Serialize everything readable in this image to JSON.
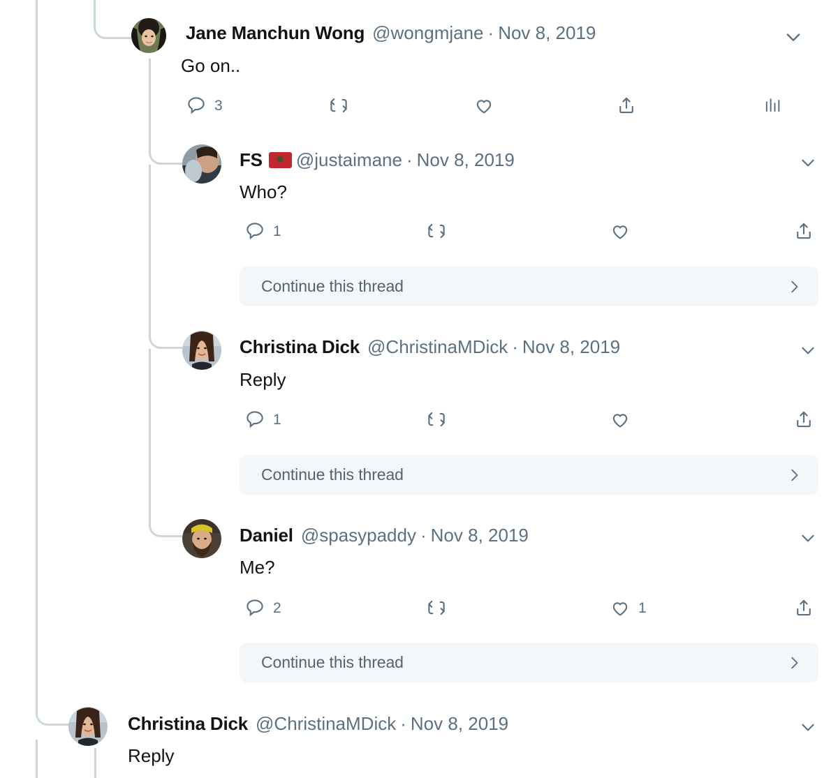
{
  "theme": {
    "background": "#ffffff",
    "text_primary": "#0f1419",
    "text_secondary": "#5b7083",
    "connector": "#ccd6dd",
    "banner_bg": "#f4f7f9",
    "banner_text": "#536471",
    "flag_red": "#c1272d",
    "flag_green": "#006233"
  },
  "tweets": [
    {
      "id": "jane-go-on",
      "display_name": "Jane Manchun Wong",
      "handle": "@wongmjane",
      "separator": "·",
      "date": "Nov 8, 2019",
      "body": "Go on..",
      "caret": "chevron-down",
      "actions": {
        "reply": "3",
        "retweet": "",
        "like": "",
        "share": "",
        "analytics": ""
      },
      "has_analytics": true,
      "continue_thread": null
    },
    {
      "id": "fs-who",
      "display_name": "FS",
      "flag": "morocco",
      "handle": "@justaimane",
      "separator": "·",
      "date": "Nov 8, 2019",
      "body": "Who?",
      "caret": "chevron-down",
      "actions": {
        "reply": "1",
        "retweet": "",
        "like": "",
        "share": ""
      },
      "has_analytics": false,
      "continue_thread": "Continue this thread"
    },
    {
      "id": "christina-reply-1",
      "display_name": "Christina Dick",
      "handle": "@ChristinaMDick",
      "separator": "·",
      "date": "Nov 8, 2019",
      "body": "Reply",
      "caret": "chevron-down",
      "actions": {
        "reply": "1",
        "retweet": "",
        "like": "",
        "share": ""
      },
      "has_analytics": false,
      "continue_thread": "Continue this thread"
    },
    {
      "id": "daniel-me",
      "display_name": "Daniel",
      "handle": "@spasypaddy",
      "separator": "·",
      "date": "Nov 8, 2019",
      "body": "Me?",
      "caret": "chevron-down",
      "actions": {
        "reply": "2",
        "retweet": "",
        "like": "1",
        "share": ""
      },
      "has_analytics": false,
      "continue_thread": "Continue this thread"
    },
    {
      "id": "christina-reply-2",
      "display_name": "Christina Dick",
      "handle": "@ChristinaMDick",
      "separator": "·",
      "date": "Nov 8, 2019",
      "body": "Reply",
      "caret": "chevron-down",
      "actions": null,
      "has_analytics": false,
      "continue_thread": null
    }
  ]
}
